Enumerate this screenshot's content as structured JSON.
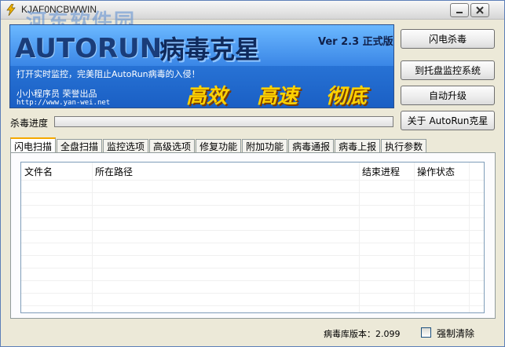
{
  "window": {
    "title": "KJAF0NCBWWIN",
    "watermark": "河东软件园"
  },
  "banner": {
    "logo_text": "AUTORUN",
    "logo_cn": "病毒克星",
    "version": "Ver 2.3 正式版",
    "slogan": "打开实时监控，完美阻止AutoRun病毒的入侵！",
    "author": "小小程序员 荣誉出品",
    "url": "http://www.yan-wei.net",
    "features": [
      "高效",
      "高速",
      "彻底"
    ]
  },
  "buttons": {
    "flash_kill": "闪电杀毒",
    "to_tray": "到托盘监控系统",
    "auto_update": "自动升级",
    "about": "关于 AutoRun克星"
  },
  "progress": {
    "label": "杀毒进度",
    "value": 0
  },
  "tabs": [
    "闪电扫描",
    "全盘扫描",
    "监控选项",
    "高级选项",
    "修复功能",
    "附加功能",
    "病毒通报",
    "病毒上报",
    "执行参数"
  ],
  "active_tab": 0,
  "list": {
    "columns": [
      "文件名",
      "所在路径",
      "结束进程",
      "操作状态"
    ],
    "rows": []
  },
  "status": {
    "db_version": "病毒库版本：2.099",
    "force_clear_label": "强制清除",
    "force_clear_checked": false
  }
}
